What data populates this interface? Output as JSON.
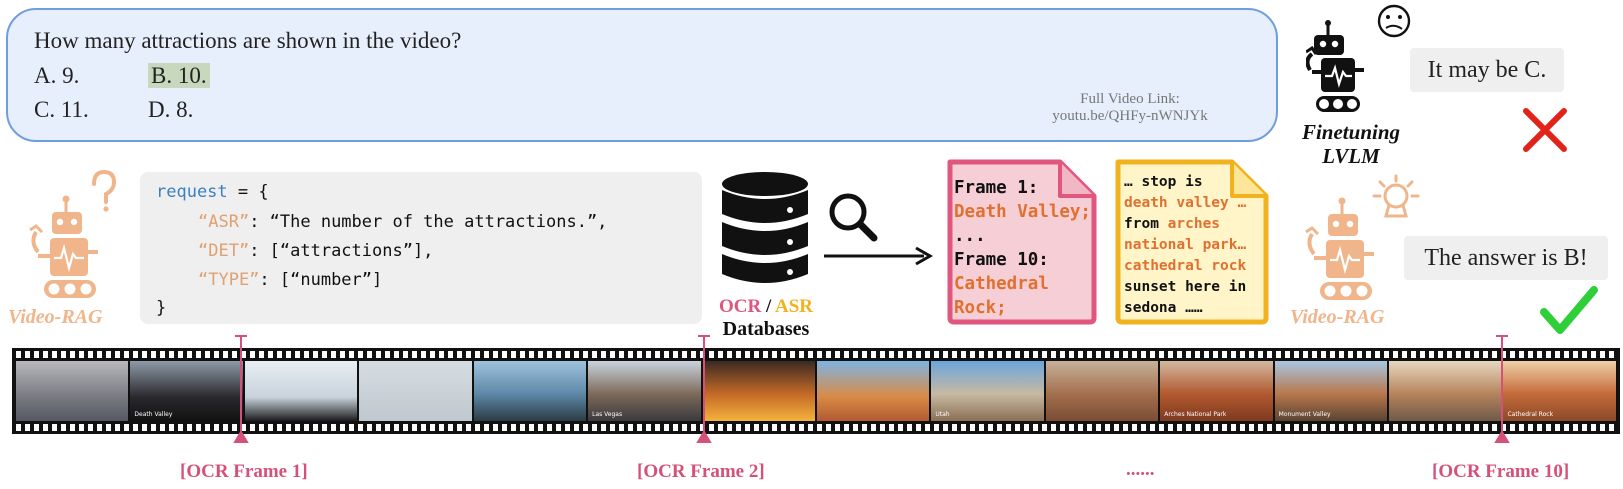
{
  "question": {
    "text": "How many attractions are shown in the video?",
    "option_a": "A. 9.",
    "option_b": "B. 10.",
    "option_c": "C. 11.",
    "option_d": "D. 8.",
    "highlighted_option": "B",
    "video_link_label": "Full Video Link:",
    "video_link_url": "youtu.be/QHFy-nWNJYk"
  },
  "finetuning": {
    "label_line1": "Finetuning",
    "label_line2": "LVLM",
    "answer": "It may be C.",
    "result": "wrong"
  },
  "video_rag": {
    "label": "Video-RAG",
    "answer": "The answer is B!",
    "result": "correct"
  },
  "request_code": {
    "var": "request",
    "open": " = {",
    "asr_key": "“ASR”",
    "asr_value": ": “The number of the attractions.”,",
    "det_key": "“DET”",
    "det_value": ": [“attractions”],",
    "type_key": "“TYPE”",
    "type_value": ": [“number”]",
    "close": "}"
  },
  "databases": {
    "ocr": "OCR",
    "sep": " / ",
    "asr": "ASR",
    "label": "Databases"
  },
  "ocr_doc": {
    "line1": "Frame 1:",
    "line2": "Death Valley;",
    "line3": "...",
    "line4": "Frame 10:",
    "line5": "Cathedral",
    "line6": "Rock;"
  },
  "asr_doc": {
    "line1": "… stop is",
    "line2": "death valley …",
    "line3_a": "from ",
    "line3_b": "arches",
    "line4": "national park…",
    "line5": "cathedral rock",
    "line6": "sunset here in",
    "line7": "sedona ……"
  },
  "filmstrip": {
    "captions": [
      "Death Valley",
      "Las Vegas",
      "Utah",
      "Arches National Park",
      "Monument Valley",
      "Cathedral Rock"
    ],
    "markers": [
      "[OCR Frame 1]",
      "[OCR Frame 2]",
      "......",
      "[OCR Frame 10]"
    ]
  },
  "colors": {
    "ocr_pink": "#e0567e",
    "asr_yellow": "#f2b21d",
    "rag_orange": "#f0b58a",
    "check_green": "#2fcf3a",
    "cross_red": "#e2231a",
    "question_blue": "#e8effc"
  }
}
